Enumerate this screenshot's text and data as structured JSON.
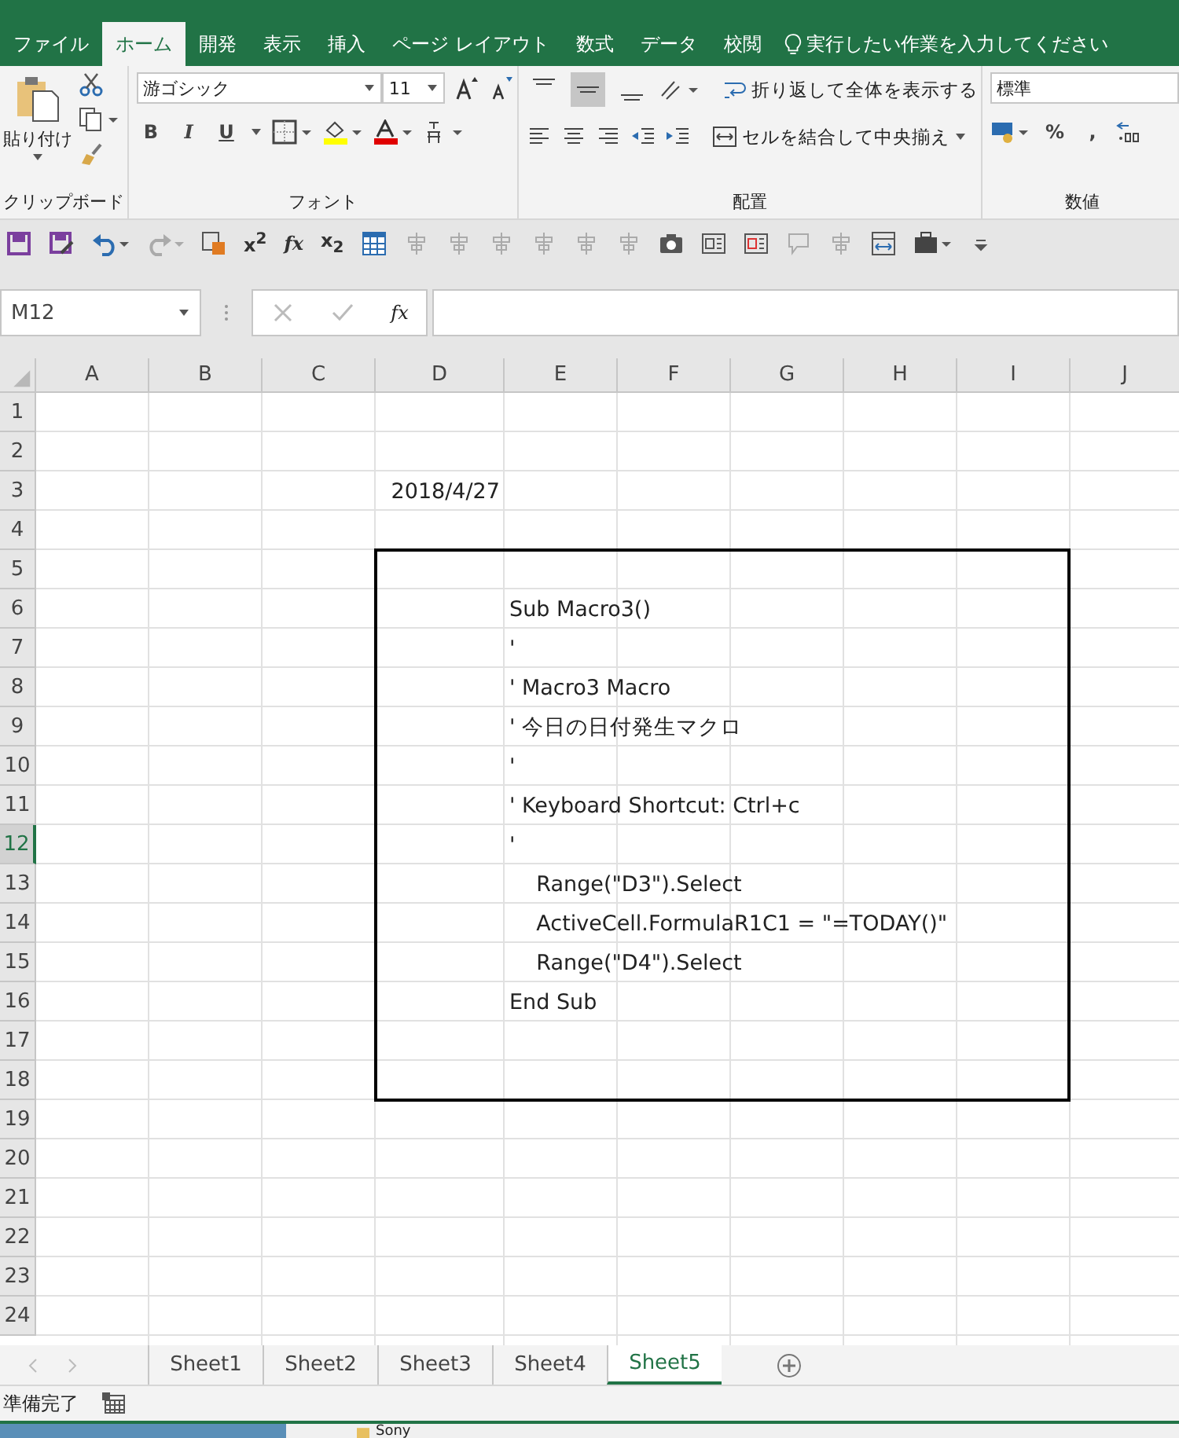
{
  "tabs": [
    {
      "label": "ファイル",
      "selected": false
    },
    {
      "label": "ホーム",
      "selected": true
    },
    {
      "label": "開発",
      "selected": false
    },
    {
      "label": "表示",
      "selected": false
    },
    {
      "label": "挿入",
      "selected": false
    },
    {
      "label": "ページ レイアウト",
      "selected": false
    },
    {
      "label": "数式",
      "selected": false
    },
    {
      "label": "データ",
      "selected": false
    },
    {
      "label": "校閲",
      "selected": false
    }
  ],
  "tell_me": "実行したい作業を入力してください",
  "ribbon": {
    "paste_label": "貼り付け",
    "font_name": "游ゴシック",
    "font_size": "11",
    "format_buttons": [
      "B",
      "I",
      "U"
    ],
    "vertical_align": [
      {
        "selected": false
      },
      {
        "selected": true
      },
      {
        "selected": false
      }
    ],
    "wrap_text": "折り返して全体を表示する",
    "merge_center": "セルを結合して中央揃え",
    "number_format": "標準",
    "percent": "%",
    "comma": ",",
    "groups": [
      "クリップボード",
      "フォント",
      "配置",
      "数値"
    ]
  },
  "quick_access": [
    {
      "kind": "save"
    },
    {
      "kind": "save-as"
    },
    {
      "kind": "undo"
    },
    {
      "kind": "redo"
    },
    {
      "kind": "paste-special"
    },
    {
      "kind": "text",
      "label": "x$^{2}$"
    },
    {
      "kind": "italic-text",
      "label": "fx"
    },
    {
      "kind": "text",
      "label": "x$_{2}$"
    },
    {
      "kind": "table"
    },
    {
      "kind": "gray"
    },
    {
      "kind": "gray"
    },
    {
      "kind": "gray"
    },
    {
      "kind": "gray"
    },
    {
      "kind": "gray"
    },
    {
      "kind": "gray"
    },
    {
      "kind": "camera"
    },
    {
      "kind": "form"
    },
    {
      "kind": "form-red"
    },
    {
      "kind": "comment"
    },
    {
      "kind": "gray"
    },
    {
      "kind": "fit"
    },
    {
      "kind": "toolbox"
    },
    {
      "kind": "more"
    }
  ],
  "formula_bar": {
    "name_box": "M12",
    "fx": "fx"
  },
  "sheet": {
    "columns": [
      "A",
      "B",
      "C",
      "D",
      "E",
      "F",
      "G",
      "H",
      "I",
      "J"
    ],
    "border_box": {
      "shown": true
    },
    "rows": [
      {
        "header": "1",
        "selected": false,
        "cells": []
      },
      {
        "header": "2",
        "selected": false,
        "cells": []
      },
      {
        "header": "3",
        "selected": false,
        "cells": [
          null,
          null,
          null,
          {
            "text": "2018/4/27",
            "kind": "date"
          }
        ]
      },
      {
        "header": "4",
        "selected": false,
        "cells": []
      },
      {
        "header": "5",
        "selected": false,
        "cells": []
      },
      {
        "header": "6",
        "selected": false,
        "cells": [
          null,
          null,
          null,
          null,
          {
            "text": "Sub Macro3()",
            "kind": "text"
          }
        ]
      },
      {
        "header": "7",
        "selected": false,
        "cells": [
          null,
          null,
          null,
          null,
          {
            "text": "'",
            "kind": "text"
          }
        ]
      },
      {
        "header": "8",
        "selected": false,
        "cells": [
          null,
          null,
          null,
          null,
          {
            "text": "' Macro3 Macro",
            "kind": "text"
          }
        ]
      },
      {
        "header": "9",
        "selected": false,
        "cells": [
          null,
          null,
          null,
          null,
          {
            "text": "' 今日の日付発生マクロ",
            "kind": "text"
          }
        ]
      },
      {
        "header": "10",
        "selected": false,
        "cells": [
          null,
          null,
          null,
          null,
          {
            "text": "'",
            "kind": "text"
          }
        ]
      },
      {
        "header": "11",
        "selected": false,
        "cells": [
          null,
          null,
          null,
          null,
          {
            "text": "' Keyboard Shortcut: Ctrl+c",
            "kind": "text"
          }
        ]
      },
      {
        "header": "12",
        "selected": true,
        "cells": [
          null,
          null,
          null,
          null,
          {
            "text": "'",
            "kind": "text"
          }
        ]
      },
      {
        "header": "13",
        "selected": false,
        "cells": [
          null,
          null,
          null,
          null,
          {
            "text": "    Range(\"D3\").Select",
            "kind": "text"
          }
        ]
      },
      {
        "header": "14",
        "selected": false,
        "cells": [
          null,
          null,
          null,
          null,
          {
            "text": "    ActiveCell.FormulaR1C1 = \"=TODAY()\"",
            "kind": "text"
          }
        ]
      },
      {
        "header": "15",
        "selected": false,
        "cells": [
          null,
          null,
          null,
          null,
          {
            "text": "    Range(\"D4\").Select",
            "kind": "text"
          }
        ]
      },
      {
        "header": "16",
        "selected": false,
        "cells": [
          null,
          null,
          null,
          null,
          {
            "text": "End Sub",
            "kind": "text"
          }
        ]
      },
      {
        "header": "17",
        "selected": false,
        "cells": []
      },
      {
        "header": "18",
        "selected": false,
        "cells": []
      },
      {
        "header": "19",
        "selected": false,
        "cells": []
      },
      {
        "header": "20",
        "selected": false,
        "cells": []
      },
      {
        "header": "21",
        "selected": false,
        "cells": []
      },
      {
        "header": "22",
        "selected": false,
        "cells": []
      },
      {
        "header": "23",
        "selected": false,
        "cells": []
      },
      {
        "header": "24",
        "selected": false,
        "cells": []
      }
    ]
  },
  "sheet_tabs": [
    {
      "label": "Sheet1",
      "selected": false
    },
    {
      "label": "Sheet2",
      "selected": false
    },
    {
      "label": "Sheet3",
      "selected": false
    },
    {
      "label": "Sheet4",
      "selected": false
    },
    {
      "label": "Sheet5",
      "selected": true
    }
  ],
  "status_bar": {
    "text": "準備完了"
  },
  "desktop": {
    "folder_label": "Sony"
  }
}
